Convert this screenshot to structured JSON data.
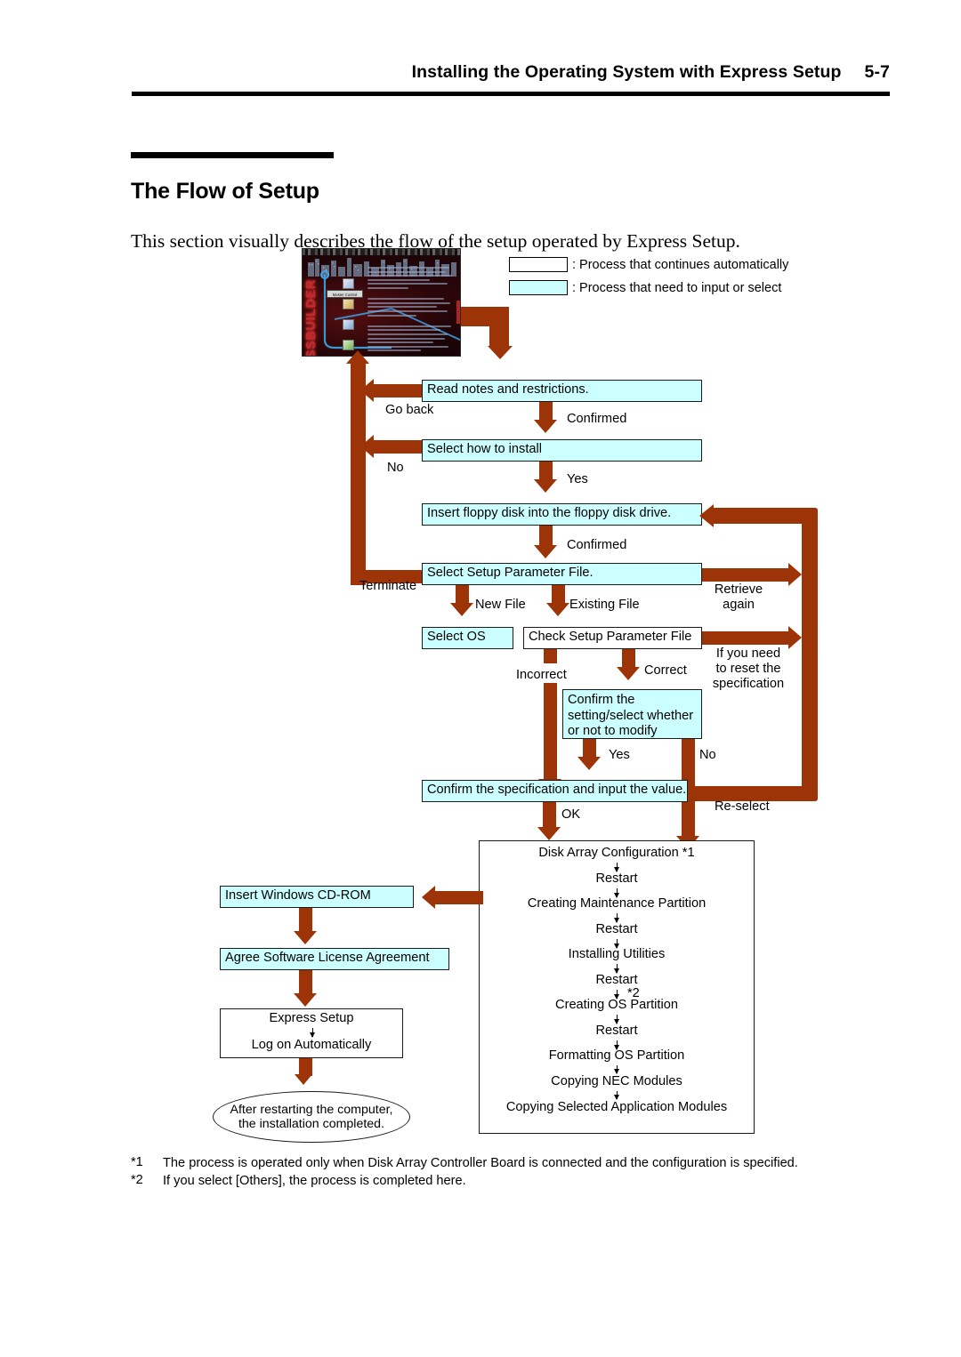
{
  "header": {
    "title": "Installing the Operating System with Express Setup",
    "page_number": "5-7"
  },
  "section": {
    "title": "The Flow of Setup",
    "intro": "This section visually describes the flow of the setup operated by Express Setup."
  },
  "legend": {
    "auto": ": Process that continues automatically",
    "input": ": Process that need to input or select"
  },
  "splash": {
    "product_name": "EXPRESSBUILDER",
    "tooltip": "Master Control"
  },
  "flow": {
    "read_notes": "Read notes and restrictions.",
    "select_how": "Select how to install",
    "insert_floppy": "Insert floppy disk into the floppy disk drive.",
    "select_param": "Select Setup Parameter File.",
    "select_os": "Select OS",
    "check_param": "Check Setup Parameter File",
    "confirm_modify": "Confirm the setting/select whether or not to modify",
    "confirm_value": "Confirm the specification and input the value.",
    "insert_cd": "Insert Windows CD-ROM",
    "agree_license": "Agree Software License Agreement",
    "express_setup": "Express Setup",
    "log_on": "Log on Automatically",
    "final": "After restarting the computer, the installation completed."
  },
  "edges": {
    "go_back": "Go back",
    "confirmed_1": "Confirmed",
    "no_1": "No",
    "yes_1": "Yes",
    "confirmed_2": "Confirmed",
    "terminate": "Terminate",
    "new_file": "New File",
    "existing_file": "Existing File",
    "retrieve_again": "Retrieve again",
    "incorrect": "Incorrect",
    "correct": "Correct",
    "reset_spec": "If you need to reset the specification",
    "yes_2": "Yes",
    "no_2": "No",
    "ok": "OK",
    "re_select": "Re-select"
  },
  "process": {
    "steps": [
      "Disk Array Configuration *1",
      "Restart",
      "Creating Maintenance Partition",
      "Restart",
      "Installing Utilities",
      "Restart",
      "Creating OS Partition",
      "Restart",
      "Formatting OS Partition",
      "Copying NEC Modules",
      "Copying Selected Application Modules"
    ],
    "footnote_marker_2": "*2"
  },
  "footnotes": [
    {
      "marker": "*1",
      "text": "The process is operated only when Disk Array Controller Board is connected and the configuration is specified."
    },
    {
      "marker": "*2",
      "text": "If you select [Others], the process is completed here."
    }
  ],
  "colors": {
    "arrow": "#9c3408",
    "input_box_fill": "#ccffff",
    "auto_box_fill": "#ffffff",
    "text": "#000000"
  }
}
